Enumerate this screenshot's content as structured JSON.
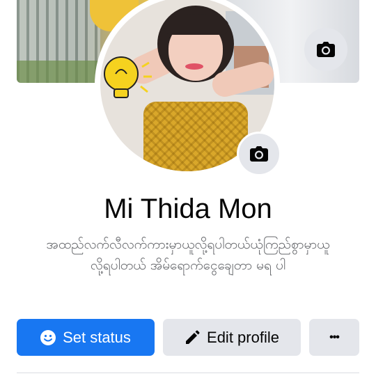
{
  "profile": {
    "name": "Mi Thida Mon",
    "bio_line1": "အထည်လက်လီလက်ကားမှာယူလို့ရပါတယ်ယုံကြည်စွာမှာယူ",
    "bio_line2": "လို့ရပါတယ် အိမ်ရောက်ငွေချေတာ မရ ပါ"
  },
  "actions": {
    "set_status_label": "Set status",
    "edit_profile_label": "Edit profile",
    "more_label": "•••"
  },
  "icons": {
    "cover_camera": "camera-icon",
    "avatar_camera": "camera-icon",
    "status": "smiley-icon",
    "edit": "pencil-icon"
  },
  "colors": {
    "primary": "#1877f2",
    "secondary_button": "#e4e6eb",
    "text_primary": "#050505",
    "text_secondary": "#65676b"
  }
}
